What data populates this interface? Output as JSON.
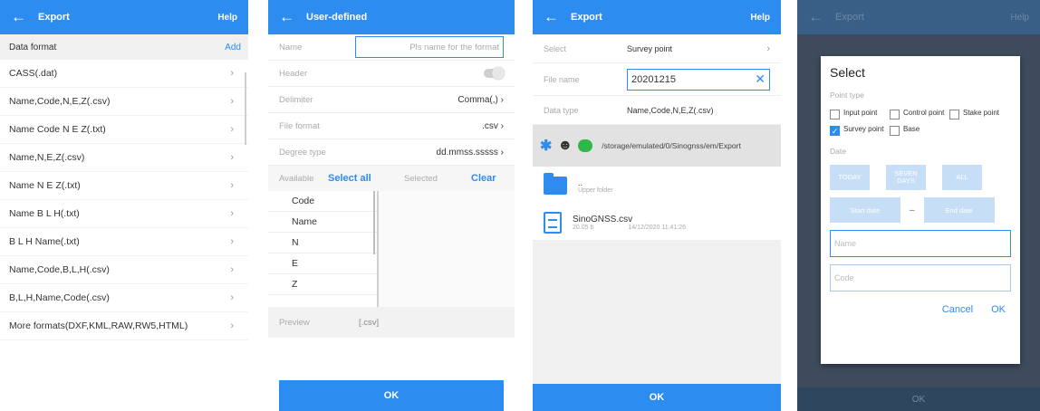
{
  "screen1": {
    "title": "Export",
    "help": "Help",
    "section": "Data format",
    "add": "Add",
    "formats": [
      "CASS(.dat)",
      "Name,Code,N,E,Z(.csv)",
      "Name Code N E Z(.txt)",
      "Name,N,E,Z(.csv)",
      "Name N E Z(.txt)",
      "Name B L H(.txt)",
      "B L H Name(.txt)",
      "Name,Code,B,L,H(.csv)",
      "B,L,H,Name,Code(.csv)",
      "More formats(DXF,KML,RAW,RW5,HTML)"
    ]
  },
  "screen2": {
    "title": "User-defined",
    "name_label": "Name",
    "name_placeholder": "Pls name for the format",
    "header_label": "Header",
    "delimiter_label": "Delimiter",
    "delimiter_value": "Comma(,)",
    "file_format_label": "File format",
    "file_format_value": ".csv",
    "degree_label": "Degree type",
    "degree_value": "dd.mmss.sssss",
    "available_label": "Available",
    "select_all": "Select all",
    "selected_label": "Selected",
    "clear": "Clear",
    "fields": [
      "Code",
      "Name",
      "N",
      "E",
      "Z"
    ],
    "preview_label": "Preview",
    "preview_value": "[.csv]",
    "ok": "OK"
  },
  "screen3": {
    "title": "Export",
    "help": "Help",
    "select_label": "Select",
    "select_value": "Survey point",
    "filename_label": "File name",
    "filename_value": "20201215",
    "datatype_label": "Data type",
    "datatype_value": "Name,Code,N,E,Z(.csv)",
    "path": "/storage/emulated/0/Sinognss/em/Export",
    "upper_folder_name": "..",
    "upper_folder": "Upper folder",
    "file_name": "SinoGNSS.csv",
    "file_size": "20.05 b",
    "file_time": "14/12/2020 11:41:26",
    "ok": "OK"
  },
  "screen4": {
    "bg_title": "Export",
    "bg_help": "Help",
    "bg_ok": "OK",
    "dialog_title": "Select",
    "point_type_label": "Point type",
    "point_types": [
      {
        "label": "Input point",
        "checked": false
      },
      {
        "label": "Control point",
        "checked": false
      },
      {
        "label": "Stake point",
        "checked": false
      },
      {
        "label": "Survey point",
        "checked": true
      },
      {
        "label": "Base",
        "checked": false
      }
    ],
    "date_label": "Date",
    "today": "TODAY",
    "seven_days": "SEVEN DAYS",
    "all": "ALL",
    "start_date": "Start date",
    "dash": "–",
    "end_date": "End date",
    "name_placeholder": "Name",
    "code_placeholder": "Code",
    "cancel": "Cancel",
    "ok": "OK"
  },
  "icons": {
    "back": "←",
    "chevron": "›",
    "close": "✕",
    "bluetooth": "✱",
    "qq": "☻",
    "check": "✓"
  },
  "colors": {
    "accent": "#2d8cf0",
    "dialog_button": "#c7dff6",
    "overlay": "#3d4b5c"
  }
}
